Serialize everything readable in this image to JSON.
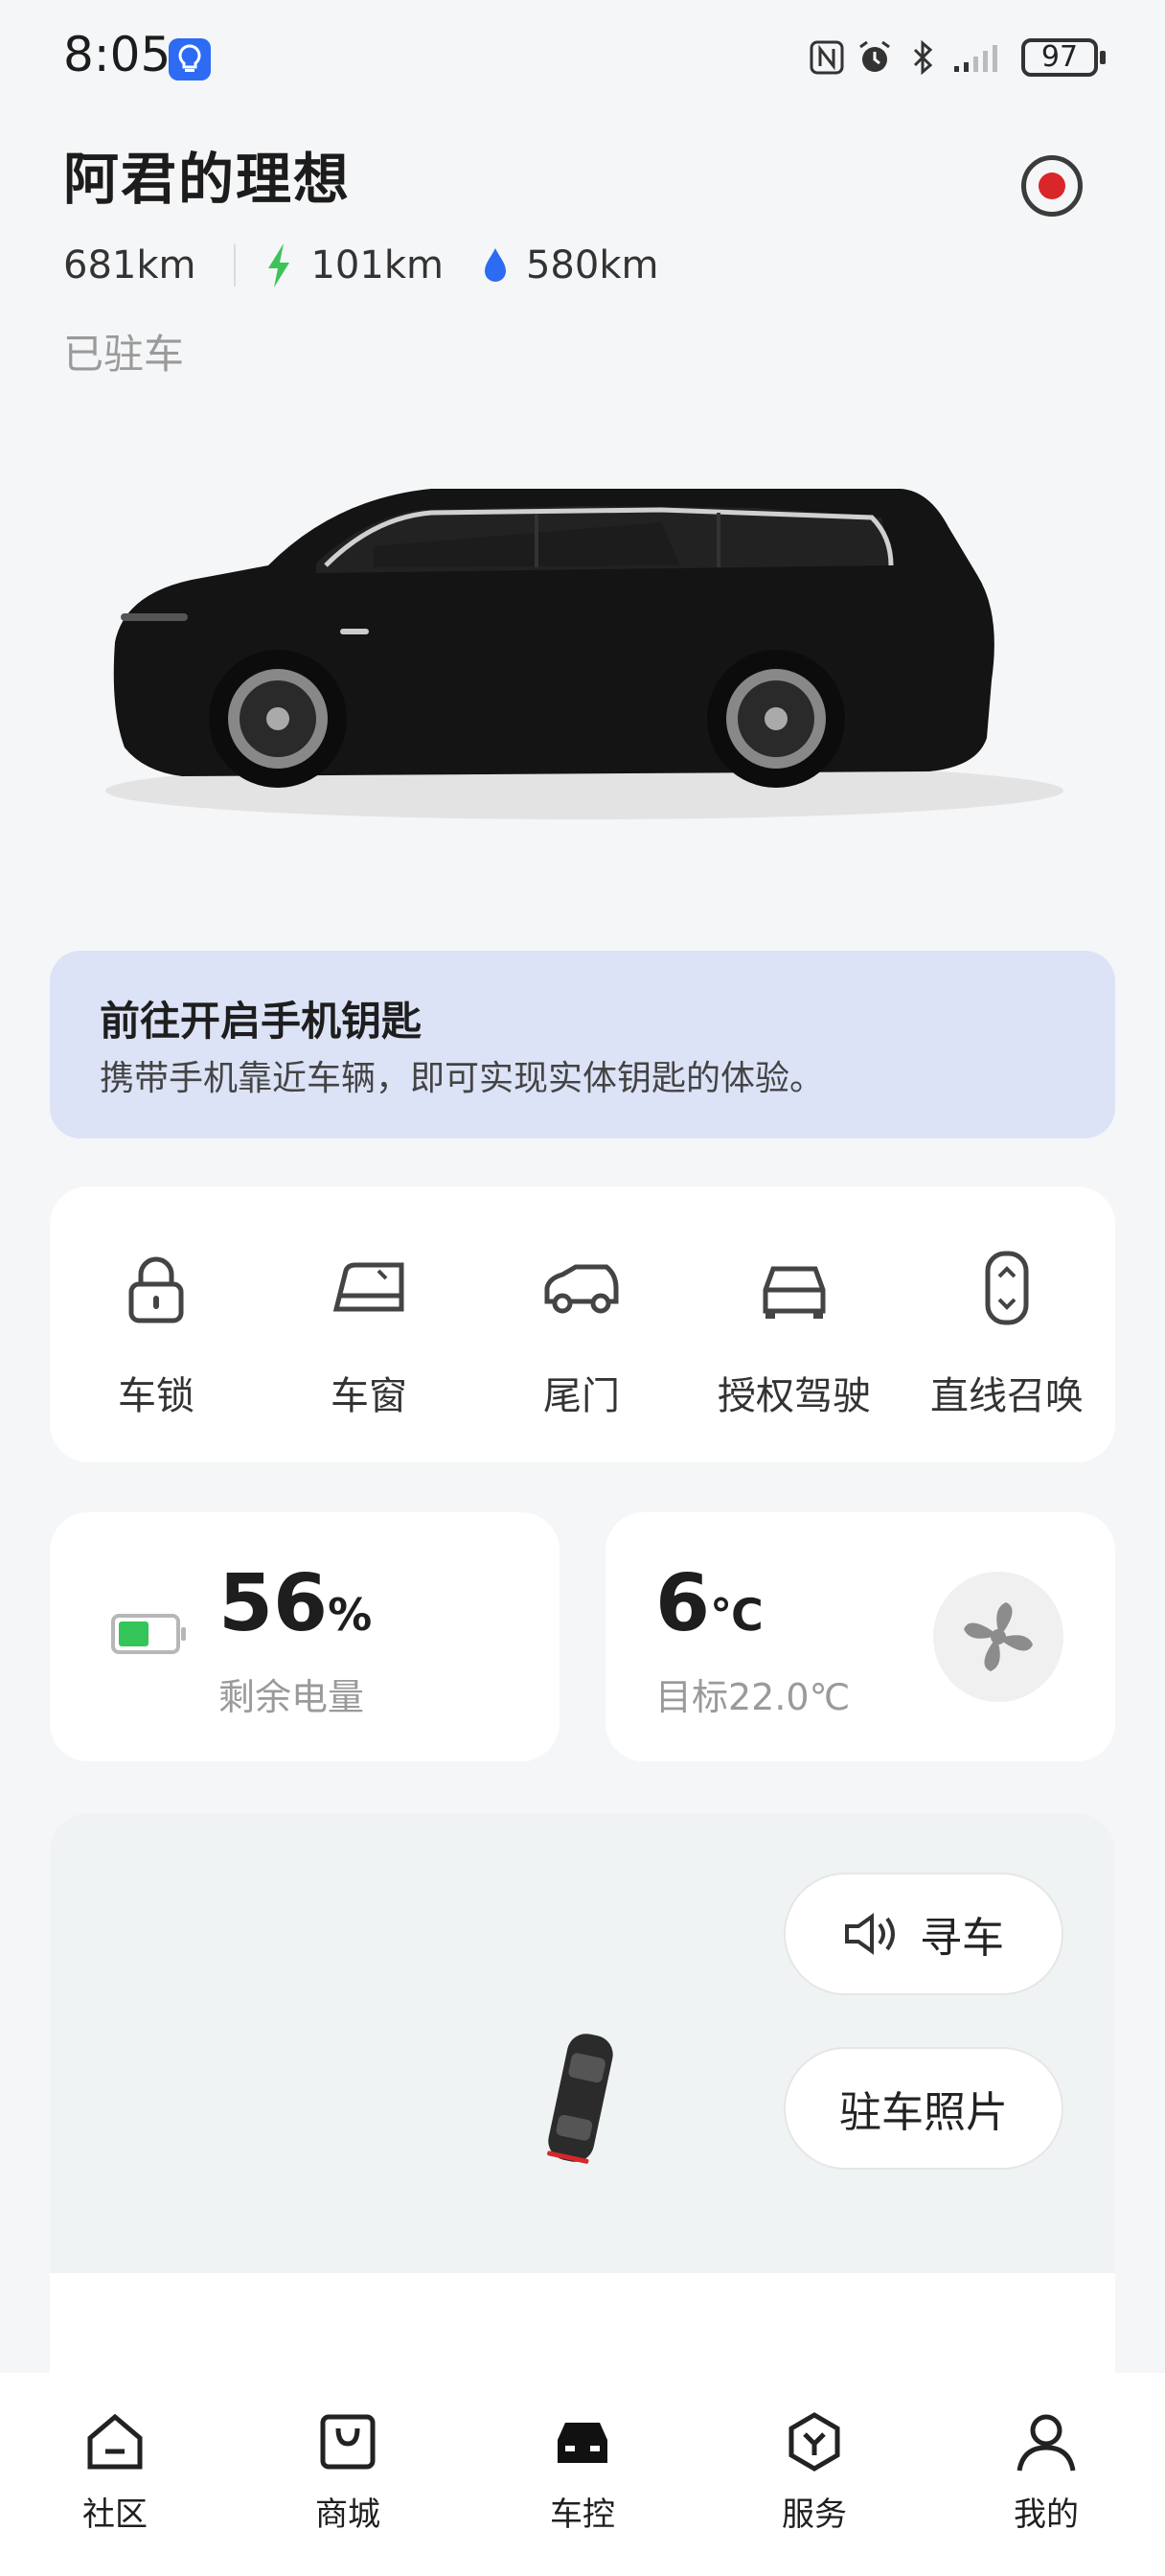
{
  "status_bar": {
    "time": "8:05",
    "battery": "97"
  },
  "header": {
    "title": "阿君的理想",
    "total_range": "681km",
    "electric_range": "101km",
    "fuel_range": "580km",
    "state": "已驻车"
  },
  "banner": {
    "title": "前往开启手机钥匙",
    "subtitle": "携带手机靠近车辆，即可实现实体钥匙的体验。"
  },
  "quick_actions": [
    {
      "label": "车锁",
      "icon": "lock-icon"
    },
    {
      "label": "车窗",
      "icon": "window-icon"
    },
    {
      "label": "尾门",
      "icon": "tailgate-icon"
    },
    {
      "label": "授权驾驶",
      "icon": "car-front-icon"
    },
    {
      "label": "直线召唤",
      "icon": "summon-icon"
    }
  ],
  "battery_card": {
    "percent": "56",
    "unit": "%",
    "label": "剩余电量",
    "level": 0.56
  },
  "climate_card": {
    "temp": "6",
    "unit": "℃",
    "target": "目标22.0℃"
  },
  "map_buttons": {
    "find_car": "寻车",
    "parking_photo": "驻车照片"
  },
  "bottom_nav": [
    {
      "label": "社区",
      "icon": "home-icon"
    },
    {
      "label": "商城",
      "icon": "shop-icon"
    },
    {
      "label": "车控",
      "icon": "car-control-icon"
    },
    {
      "label": "服务",
      "icon": "service-icon"
    },
    {
      "label": "我的",
      "icon": "profile-icon"
    }
  ],
  "colors": {
    "accent_blue": "#2d6bf2",
    "banner_bg": "#dce3f7",
    "green": "#34c55a",
    "record_red": "#d8262a"
  }
}
